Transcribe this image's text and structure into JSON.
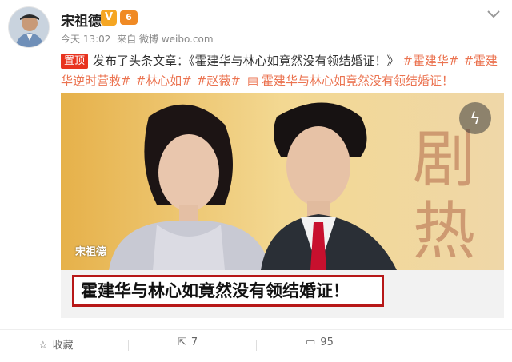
{
  "post": {
    "author": "宋祖德",
    "verified_badge": "V",
    "vip_badge": "6",
    "time": "今天 13:02",
    "source": "来自 微博 weibo.com",
    "top_badge": "置顶",
    "text_prefix": "发布了头条文章：《霍建华与林心如竟然没有领结婚证！》",
    "tags": [
      "#霍建华#",
      "#霍建华逆时营救#",
      "#林心如#",
      "#赵薇#"
    ],
    "doc_link": "霍建华与林心如竟然没有领结婚证！"
  },
  "card": {
    "watermark": "宋祖德",
    "headline": "霍建华与林心如竟然没有领结婚证！",
    "bg_chars": "剧 热"
  },
  "actions": {
    "favorite_label": "收藏",
    "share_count": "7",
    "comment_count": "95"
  },
  "icons": {
    "more": "chevron-down-icon",
    "play": "lightning-icon",
    "favorite": "star-icon",
    "share": "share-icon",
    "comment": "comment-icon",
    "doc": "document-icon"
  },
  "colors": {
    "accent": "#eb7350",
    "top_badge": "#e8331f",
    "headline_border": "#b71818"
  }
}
